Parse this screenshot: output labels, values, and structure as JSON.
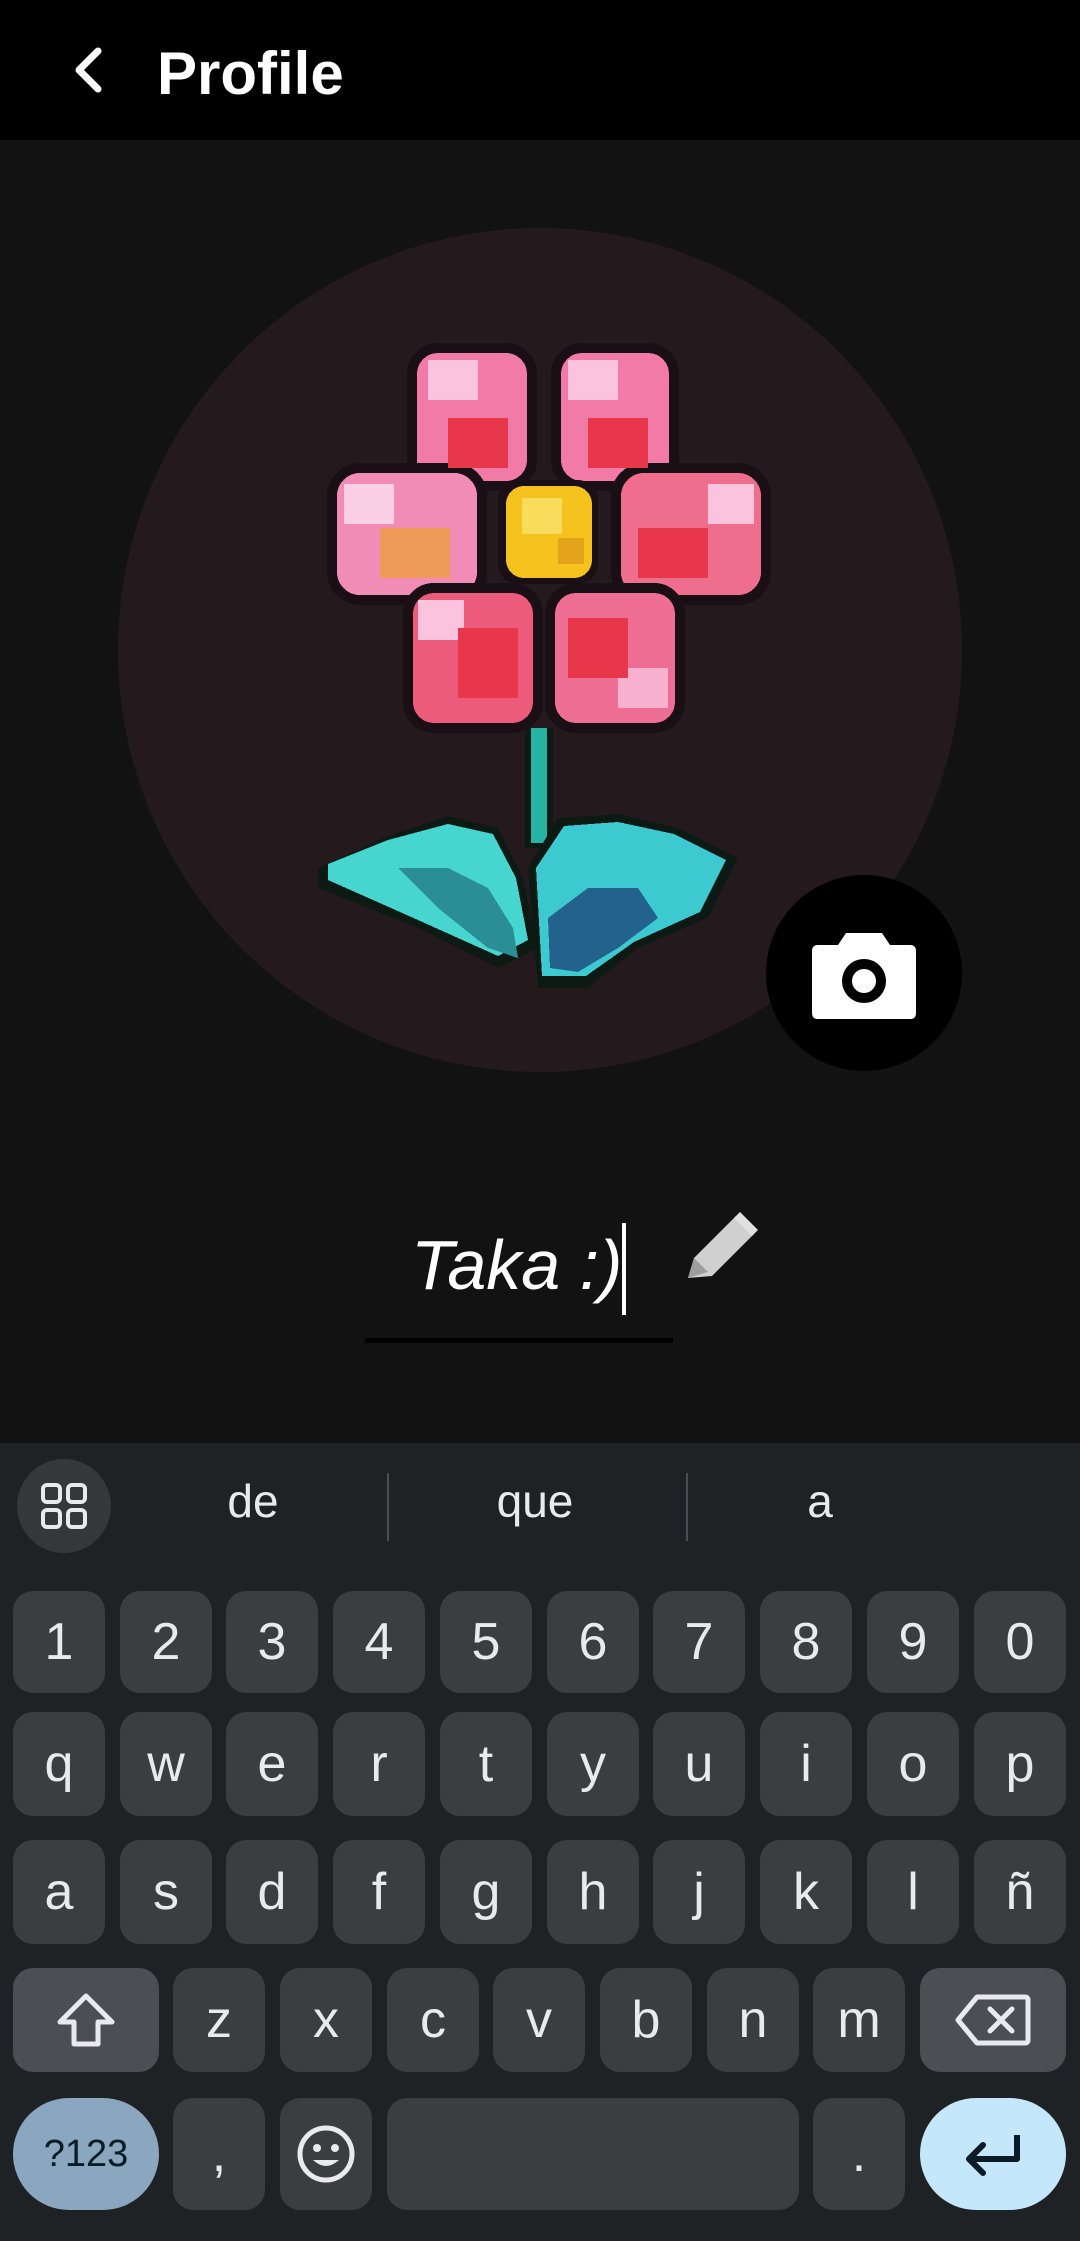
{
  "appbar": {
    "title": "Profile"
  },
  "profile": {
    "name": "Taka :)"
  },
  "keyboard": {
    "suggestions": [
      "de",
      "que",
      "a"
    ],
    "row_numbers": [
      "1",
      "2",
      "3",
      "4",
      "5",
      "6",
      "7",
      "8",
      "9",
      "0"
    ],
    "row_q": [
      "q",
      "w",
      "e",
      "r",
      "t",
      "y",
      "u",
      "i",
      "o",
      "p"
    ],
    "row_a": [
      "a",
      "s",
      "d",
      "f",
      "g",
      "h",
      "j",
      "k",
      "l",
      "ñ"
    ],
    "row_z": [
      "z",
      "x",
      "c",
      "v",
      "b",
      "n",
      "m"
    ],
    "symbols_label": "?123",
    "comma": ",",
    "period": "."
  },
  "colors": {
    "appbar_bg": "#000000",
    "page_bg": "#121212",
    "avatar_bg": "#241a1d",
    "keyboard_bg": "#1f2224",
    "key_bg": "#3a3e41",
    "enter_key_bg": "#c5e7fb",
    "symbols_key_bg": "#8ba7bf"
  },
  "icons": {
    "back": "chevron-left-icon",
    "camera": "camera-icon",
    "edit": "pencil-icon",
    "apps": "grid-icon",
    "shift": "shift-icon",
    "backspace": "backspace-icon",
    "emoji": "emoji-icon",
    "enter": "enter-icon"
  }
}
